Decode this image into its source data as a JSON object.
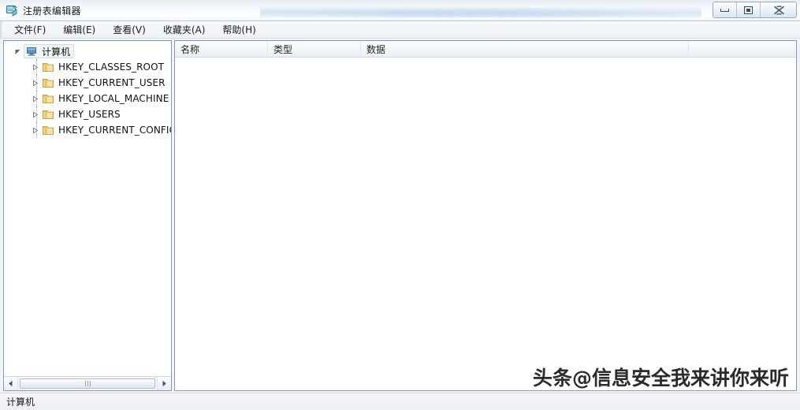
{
  "window": {
    "title": "注册表编辑器",
    "icon": "regedit-icon",
    "controls": {
      "minimize_label": "最小化",
      "maximize_label": "最大化",
      "close_label": "关闭"
    }
  },
  "menubar": {
    "items": [
      {
        "label": "文件(F)",
        "name": "menu-file"
      },
      {
        "label": "编辑(E)",
        "name": "menu-edit"
      },
      {
        "label": "查看(V)",
        "name": "menu-view"
      },
      {
        "label": "收藏夹(A)",
        "name": "menu-favorites"
      },
      {
        "label": "帮助(H)",
        "name": "menu-help"
      }
    ]
  },
  "tree": {
    "root": {
      "label": "计算机",
      "icon": "computer-icon",
      "expanded": true,
      "selected": true
    },
    "children": [
      {
        "label": "HKEY_CLASSES_ROOT",
        "icon": "folder-icon",
        "expanded": false
      },
      {
        "label": "HKEY_CURRENT_USER",
        "icon": "folder-icon",
        "expanded": false
      },
      {
        "label": "HKEY_LOCAL_MACHINE",
        "icon": "folder-icon",
        "expanded": false
      },
      {
        "label": "HKEY_USERS",
        "icon": "folder-icon",
        "expanded": false
      },
      {
        "label": "HKEY_CURRENT_CONFIG",
        "icon": "folder-icon",
        "expanded": false
      }
    ],
    "hscrollbar": {
      "left_arrow": "scroll-left-icon",
      "right_arrow": "scroll-right-icon"
    }
  },
  "list": {
    "columns": [
      {
        "label": "名称",
        "name": "column-header-name"
      },
      {
        "label": "类型",
        "name": "column-header-type"
      },
      {
        "label": "数据",
        "name": "column-header-data"
      }
    ],
    "rows": []
  },
  "statusbar": {
    "text": "计算机"
  },
  "watermark": {
    "text": "头条@信息安全我来讲你来听"
  },
  "colors": {
    "titlebar_glass": "#f4f8fb",
    "pane_border": "#8a9bad",
    "folder_gold": "#e8c05a",
    "computer_blue": "#3f86c9",
    "text": "#111111",
    "statusbar_bg": "#eceff4"
  }
}
